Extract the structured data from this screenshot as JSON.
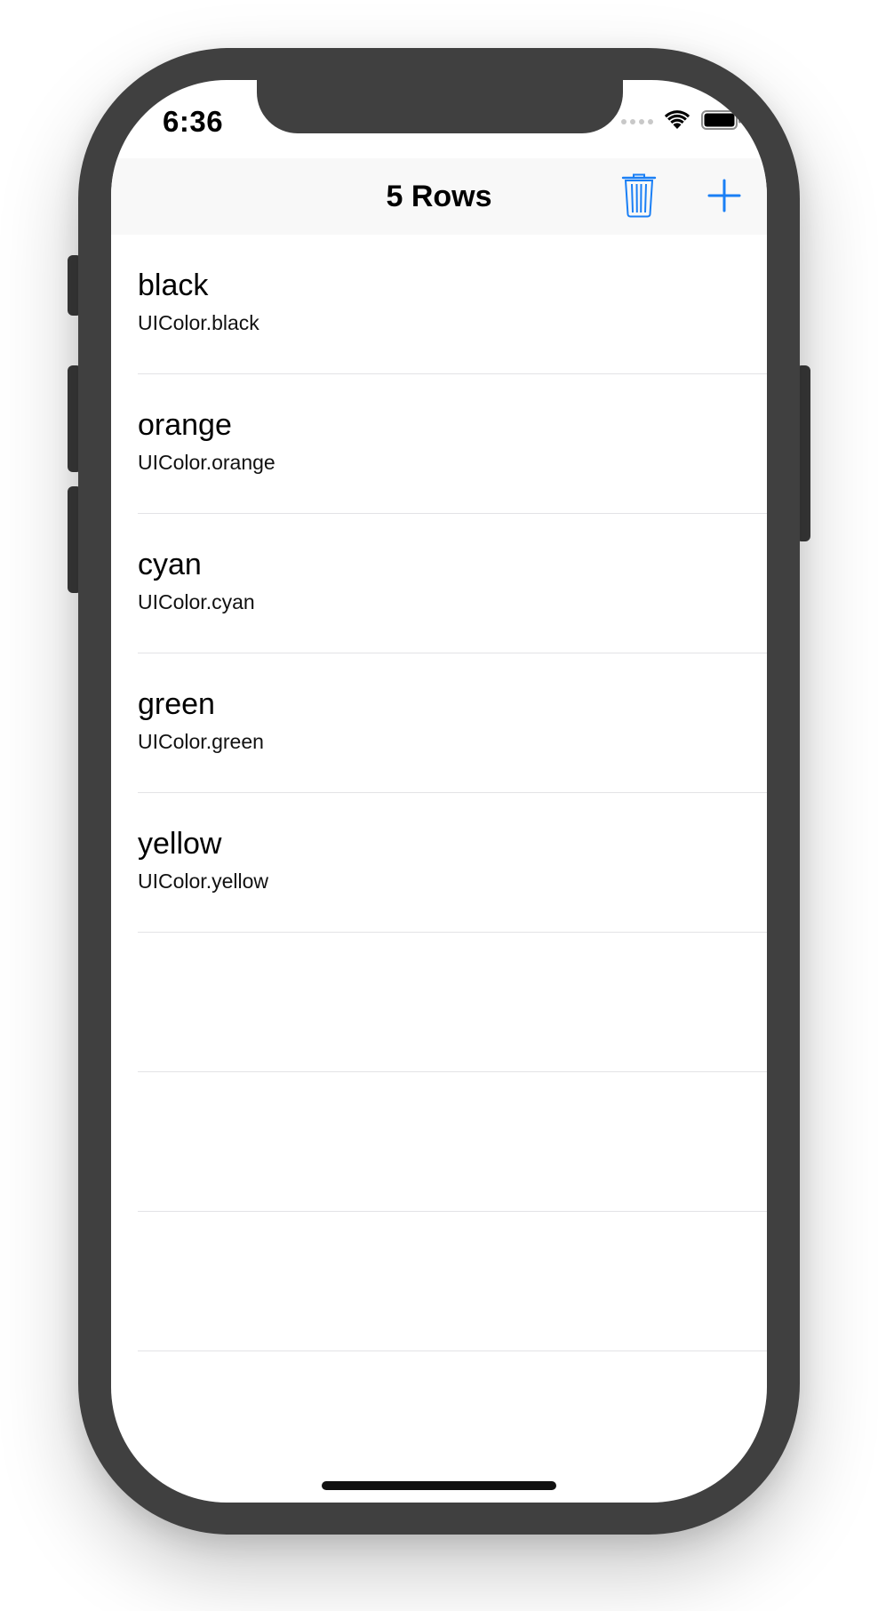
{
  "status_bar": {
    "time": "6:36"
  },
  "nav_bar": {
    "title": "5 Rows",
    "trash_icon": "trash-icon",
    "add_icon": "plus-icon"
  },
  "table": {
    "rows": [
      {
        "title": "black",
        "subtitle": "UIColor.black"
      },
      {
        "title": "orange",
        "subtitle": "UIColor.orange"
      },
      {
        "title": "cyan",
        "subtitle": "UIColor.cyan"
      },
      {
        "title": "green",
        "subtitle": "UIColor.green"
      },
      {
        "title": "yellow",
        "subtitle": "UIColor.yellow"
      }
    ],
    "empty_rows": 3
  },
  "colors": {
    "accent": "#1a7ff5",
    "device": "#404040",
    "separator": "#e3e3e6",
    "nav_background": "#f8f8f8"
  }
}
